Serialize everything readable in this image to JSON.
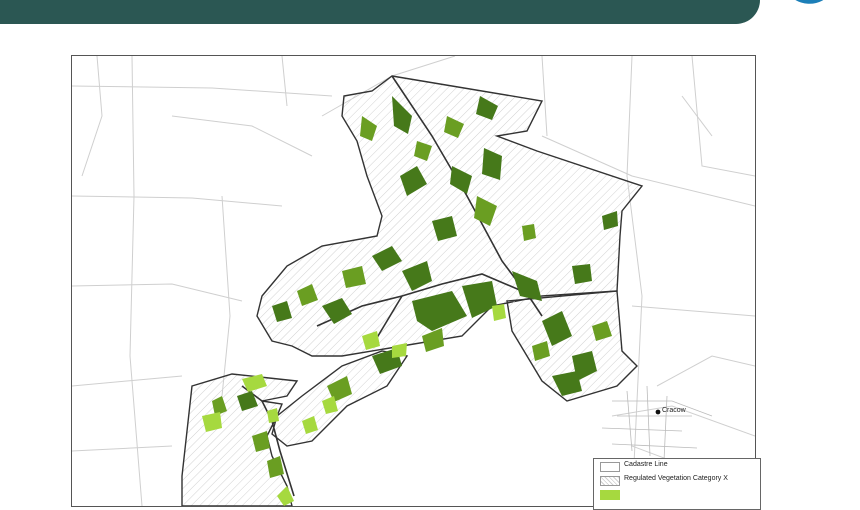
{
  "header": {
    "title": ""
  },
  "map": {
    "town_label": "Cracow",
    "colors": {
      "boundary": "#3a3a3a",
      "cadastre": "#cfcfcf",
      "hatch": "#c8c8c8",
      "vegetation_dark": "#3f6f12",
      "vegetation_mid": "#5a8f1c",
      "vegetation_light": "#9fd43a"
    }
  },
  "legend": {
    "items": [
      {
        "label": "Cadastre Line",
        "swatch": "cadastre"
      },
      {
        "label": "Regulated Vegetation Category X",
        "swatch": "hatch"
      },
      {
        "label": "",
        "swatch": "light-green"
      }
    ]
  }
}
